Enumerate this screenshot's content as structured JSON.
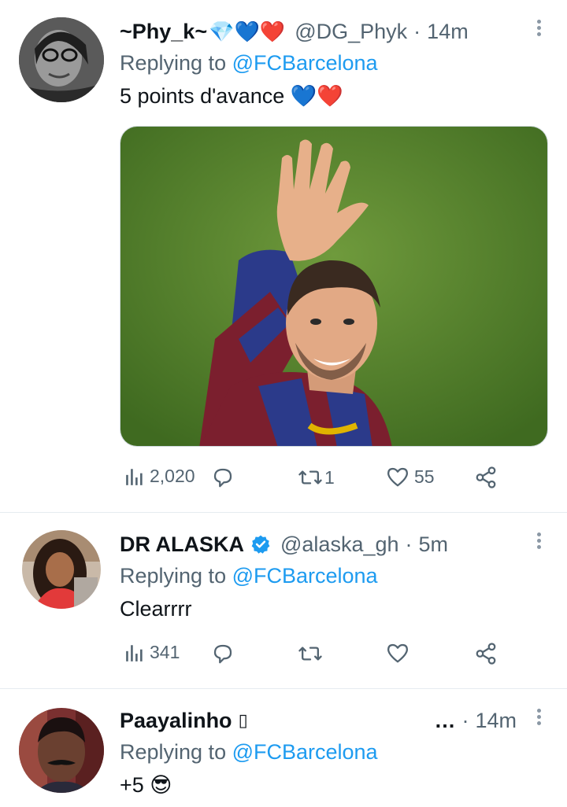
{
  "tweets": [
    {
      "display_name": "~Phy_k~",
      "name_emojis": "💎💙❤️",
      "handle": "@DG_Phyk",
      "separator": "·",
      "time": "14m",
      "replying_prefix": "Replying to ",
      "replying_to": "@FCBarcelona",
      "text": "5 points d'avance 💙❤️",
      "views": "2,020",
      "replies": "",
      "retweets": "1",
      "likes": "55"
    },
    {
      "display_name": "DR ALASKA",
      "handle": "@alaska_gh",
      "separator": "·",
      "time": "5m",
      "replying_prefix": "Replying to ",
      "replying_to": "@FCBarcelona",
      "text": "Clearrrr",
      "views": "341",
      "replies": "",
      "retweets": "",
      "likes": ""
    },
    {
      "display_name": "Paayalinho",
      "name_emojis": "▯",
      "handle": "…",
      "separator": "·",
      "time": "14m",
      "replying_prefix": "Replying to ",
      "replying_to": "@FCBarcelona",
      "text": "+5 😎"
    }
  ],
  "colors": {
    "accent": "#1d9bf0",
    "secondary_text": "#536471",
    "primary_text": "#0f1419",
    "divider": "#e6ecf0"
  },
  "icons": {
    "views": "bar-chart-icon",
    "reply": "speech-bubble-icon",
    "retweet": "retweet-icon",
    "like": "heart-icon",
    "share": "share-icon",
    "more": "vertical-dots-icon",
    "verified": "verified-badge-icon"
  }
}
